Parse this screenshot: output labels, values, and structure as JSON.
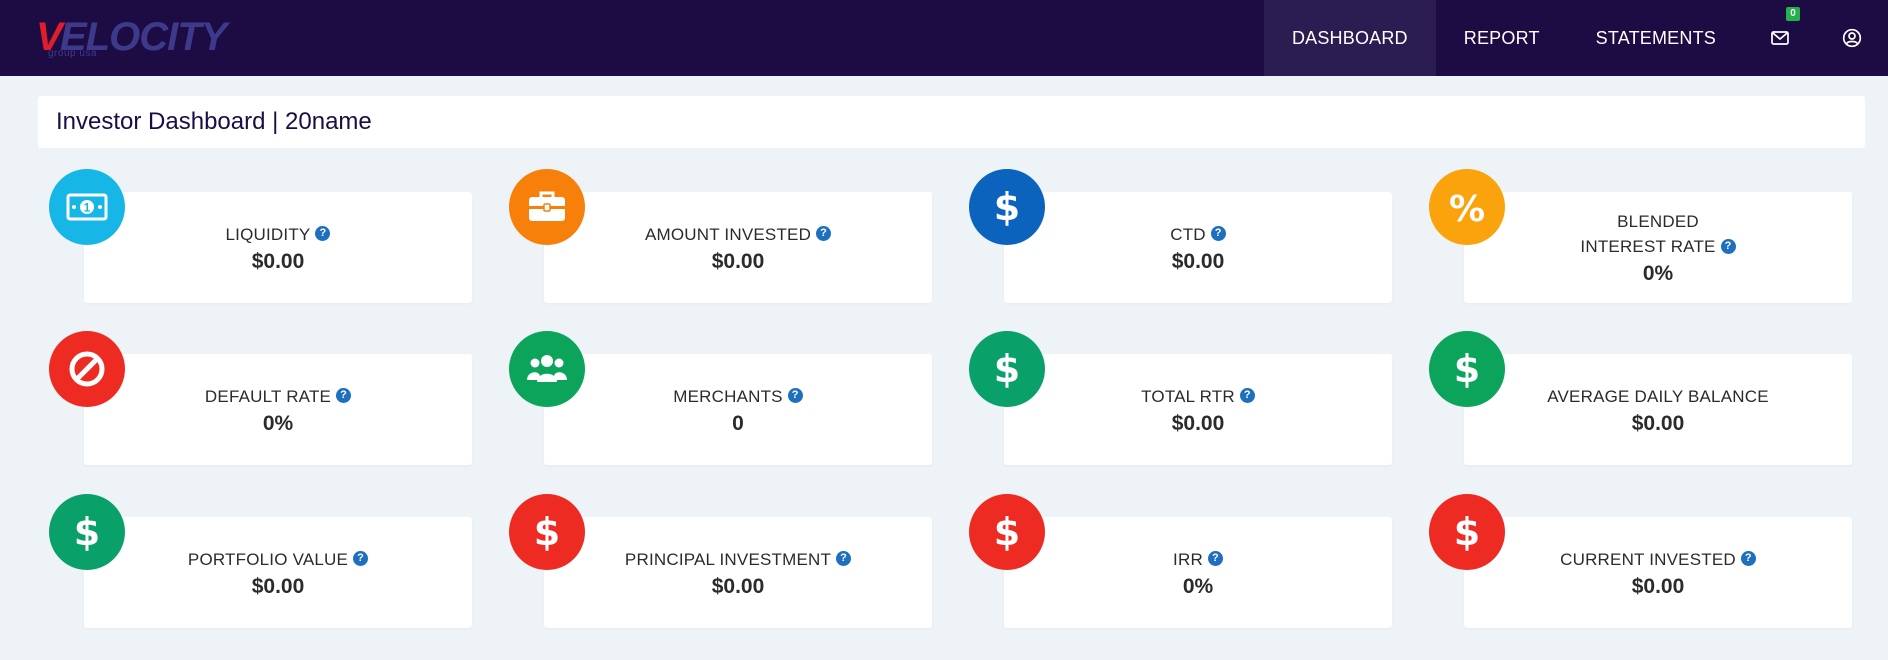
{
  "app": {
    "logo_v": "V",
    "logo_rest": "ELOCITY",
    "logo_sub": "group usa"
  },
  "nav": {
    "items": [
      {
        "label": "DASHBOARD",
        "active": true
      },
      {
        "label": "REPORT",
        "active": false
      },
      {
        "label": "STATEMENTS",
        "active": false
      }
    ],
    "mail_icon": "envelope-icon",
    "mail_count": "0",
    "user_icon": "user-circle-icon"
  },
  "page": {
    "title": "Investor Dashboard | 20name"
  },
  "colors": {
    "topbar": "#1d0c43",
    "cyan": "#16b6e6",
    "orange": "#f7800a",
    "blue": "#0b63be",
    "amber": "#fba30d",
    "red": "#ee2b22",
    "green": "#0ba45a",
    "teal_green": "#0aa06a",
    "help": "#1f6fbf"
  },
  "cards": [
    {
      "label": "LIQUIDITY",
      "value": "$0.00",
      "help": true,
      "icon": "cash-icon",
      "color": "#16b6e6"
    },
    {
      "label": "AMOUNT INVESTED",
      "value": "$0.00",
      "help": true,
      "icon": "briefcase-icon",
      "color": "#f7800a"
    },
    {
      "label": "CTD",
      "value": "$0.00",
      "help": true,
      "icon": "dollar-icon",
      "color": "#0b63be"
    },
    {
      "label_line1": "BLENDED",
      "label": "INTEREST RATE",
      "value": "0%",
      "help": true,
      "icon": "percent-icon",
      "color": "#fba30d"
    },
    {
      "label": "DEFAULT RATE",
      "value": "0%",
      "help": true,
      "icon": "ban-icon",
      "color": "#ee2b22"
    },
    {
      "label": "MERCHANTS",
      "value": "0",
      "help": true,
      "icon": "users-icon",
      "color": "#0ba45a"
    },
    {
      "label": "TOTAL RTR",
      "value": "$0.00",
      "help": true,
      "icon": "dollar-icon",
      "color": "#0aa06a"
    },
    {
      "label": "AVERAGE DAILY BALANCE",
      "value": "$0.00",
      "help": false,
      "icon": "dollar-icon",
      "color": "#0ba45a"
    },
    {
      "label": "PORTFOLIO VALUE",
      "value": "$0.00",
      "help": true,
      "icon": "dollar-icon",
      "color": "#0aa06a"
    },
    {
      "label": "PRINCIPAL INVESTMENT",
      "value": "$0.00",
      "help": true,
      "icon": "dollar-icon",
      "color": "#ee2b22"
    },
    {
      "label": "IRR",
      "value": "0%",
      "help": true,
      "icon": "dollar-icon",
      "color": "#ee2b22"
    },
    {
      "label": "CURRENT INVESTED",
      "value": "$0.00",
      "help": true,
      "icon": "dollar-icon",
      "color": "#ee2b22"
    }
  ]
}
